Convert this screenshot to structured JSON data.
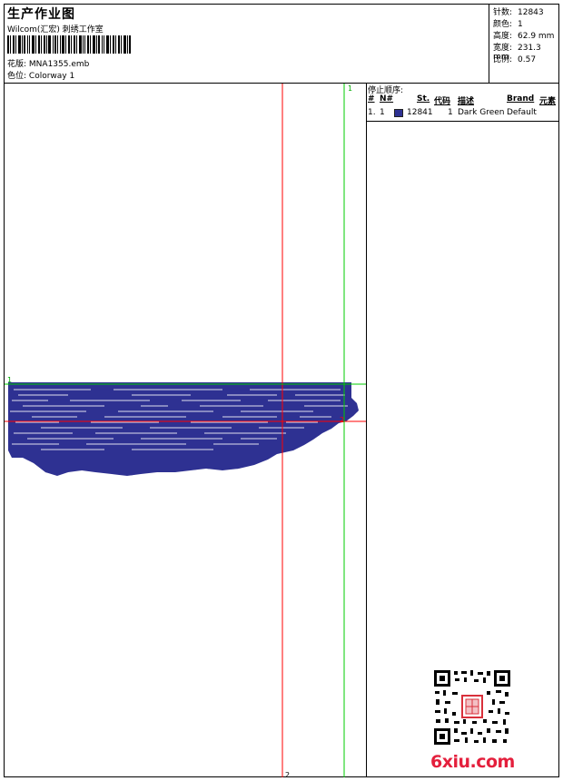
{
  "header": {
    "title": "生产作业图",
    "company": "Wilcom(汇宏) 刺绣工作室",
    "design_label": "花版:",
    "design_value": "MNA1355.emb",
    "colorway_label": "色位:",
    "colorway_value": "Colorway 1"
  },
  "stats": [
    {
      "label": "针数:",
      "value": "12843"
    },
    {
      "label": "颜色:",
      "value": "1"
    },
    {
      "label": "高度:",
      "value": "62.9 mm"
    },
    {
      "label": "宽度:",
      "value": "231.3 mm"
    },
    {
      "label": "比例:",
      "value": "0.57"
    }
  ],
  "canvas": {
    "guide_top_label": "1",
    "guide_left_label": "1",
    "guide_bottom_label": "2",
    "guide_right_label": "2",
    "thread_color": "#2e3192",
    "green_guide_color": "#00cc00",
    "red_guide_color": "#ff0000"
  },
  "stop_sequence": {
    "title": "停止顺序:",
    "headers": [
      "#",
      "N#",
      "St.",
      "代码",
      "描述",
      "Brand",
      "元素"
    ],
    "rows": [
      {
        "index": "1.",
        "n": "1",
        "stitches": "12841",
        "code": "1",
        "description": "Dark Green",
        "brand": "Default",
        "swatch_color": "#2e3192"
      }
    ]
  },
  "watermark": {
    "text": "6xiu.com",
    "color": "#e41f3c",
    "qr_icon": "qr-code-icon"
  }
}
